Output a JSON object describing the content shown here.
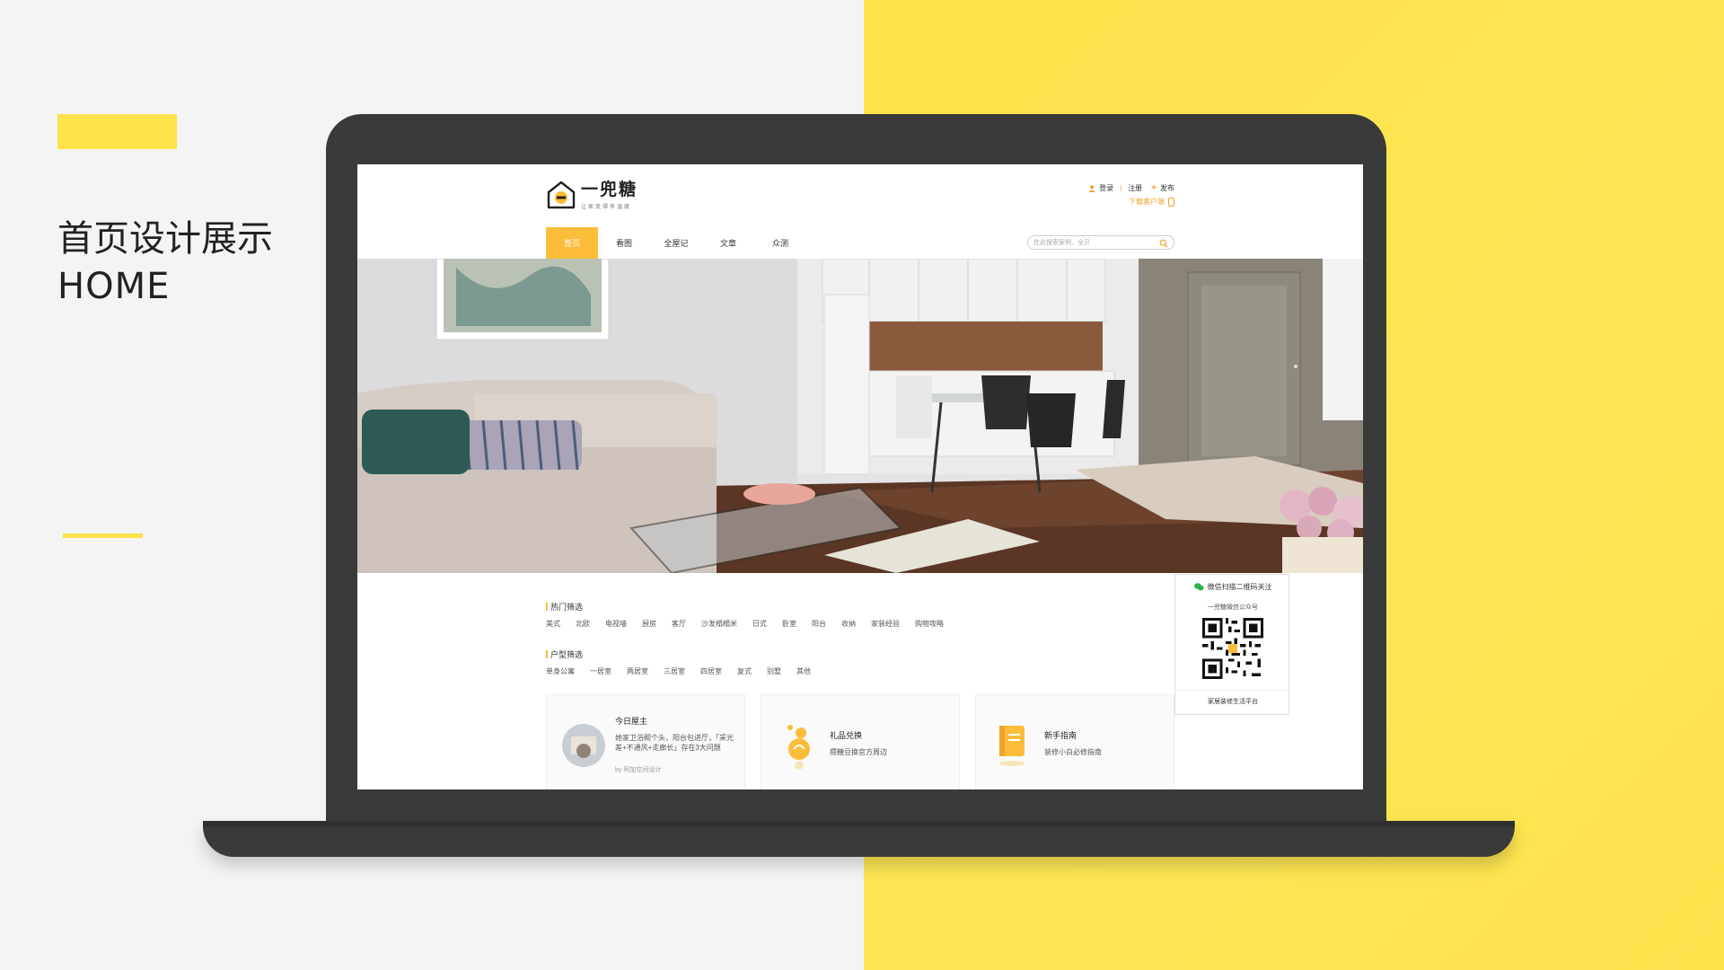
{
  "slide": {
    "title": "首页设计展示",
    "subtitle": "HOME"
  },
  "site": {
    "logo_name": "一兜糖",
    "logo_slogan": "让家变得有温度",
    "user_links": {
      "login": "登录",
      "register": "注册",
      "publish": "发布"
    },
    "download_app": "下载客户端",
    "nav": [
      "首页",
      "看图",
      "全屋记",
      "文章",
      "众测"
    ],
    "search": {
      "placeholder": "在此搜索案例、全贝"
    },
    "filters": [
      {
        "title": "热门筛选",
        "tags": [
          "美式",
          "北欧",
          "电视墙",
          "厨房",
          "客厅",
          "沙发榻榻米",
          "日式",
          "卧室",
          "阳台",
          "收纳",
          "家装经验",
          "购物攻略"
        ]
      },
      {
        "title": "户型筛选",
        "tags": [
          "单身公寓",
          "一居室",
          "两居室",
          "三居室",
          "四居室",
          "复式",
          "别墅",
          "其他"
        ]
      }
    ],
    "cards": [
      {
        "title": "今日屋主",
        "desc": "她家卫浴砌个头，阳台包进厅，「采光差+不通风+走廊长」存在3大问题",
        "by": "by 阿加空间设计",
        "icon": "avatar"
      },
      {
        "title": "礼品兑换",
        "desc": "攒糖豆换官方周边",
        "icon": "candy-icon"
      },
      {
        "title": "新手指南",
        "desc": "装修小白必修指南",
        "icon": "book-icon"
      }
    ],
    "qr": {
      "heading": "微信扫描二维码关注",
      "sub": "一兜糖微信公众号",
      "footer": "家居装修生活平台"
    }
  },
  "colors": {
    "accent_yellow": "#fde24a",
    "nav_active": "#fbbd3a",
    "link_orange": "#f3a02b",
    "laptop": "#3a3a3a"
  }
}
